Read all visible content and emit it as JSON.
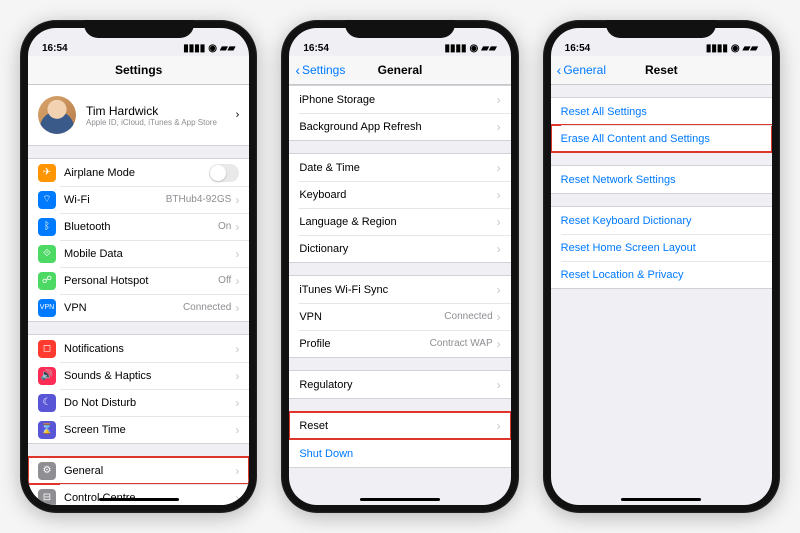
{
  "status": {
    "time": "16:54"
  },
  "phone1": {
    "title": "Settings",
    "profile": {
      "name": "Tim Hardwick",
      "sub": "Apple ID, iCloud, iTunes & App Store"
    },
    "groupA": [
      {
        "icon": "airplane-icon",
        "bg": "#ff9500",
        "label": "Airplane Mode",
        "type": "switch"
      },
      {
        "icon": "wifi-icon",
        "bg": "#007aff",
        "label": "Wi-Fi",
        "detail": "BTHub4-92GS"
      },
      {
        "icon": "bluetooth-icon",
        "bg": "#007aff",
        "label": "Bluetooth",
        "detail": "On"
      },
      {
        "icon": "mobiledata-icon",
        "bg": "#4cd964",
        "label": "Mobile Data"
      },
      {
        "icon": "hotspot-icon",
        "bg": "#4cd964",
        "label": "Personal Hotspot",
        "detail": "Off"
      },
      {
        "icon": "vpn-icon",
        "bg": "#007aff",
        "label": "VPN",
        "detail": "Connected"
      }
    ],
    "groupB": [
      {
        "icon": "notifications-icon",
        "bg": "#ff3b30",
        "label": "Notifications"
      },
      {
        "icon": "sounds-icon",
        "bg": "#ff2d55",
        "label": "Sounds & Haptics"
      },
      {
        "icon": "dnd-icon",
        "bg": "#5856d6",
        "label": "Do Not Disturb"
      },
      {
        "icon": "screentime-icon",
        "bg": "#5856d6",
        "label": "Screen Time"
      }
    ],
    "groupC": [
      {
        "icon": "general-icon",
        "bg": "#8e8e93",
        "label": "General",
        "highlight": true
      },
      {
        "icon": "control-icon",
        "bg": "#8e8e93",
        "label": "Control Centre"
      }
    ]
  },
  "phone2": {
    "title": "General",
    "back": "Settings",
    "groupA": [
      {
        "label": "iPhone Storage"
      },
      {
        "label": "Background App Refresh"
      }
    ],
    "groupB": [
      {
        "label": "Date & Time"
      },
      {
        "label": "Keyboard"
      },
      {
        "label": "Language & Region"
      },
      {
        "label": "Dictionary"
      }
    ],
    "groupC": [
      {
        "label": "iTunes Wi-Fi Sync"
      },
      {
        "label": "VPN",
        "detail": "Connected"
      },
      {
        "label": "Profile",
        "detail": "Contract WAP"
      }
    ],
    "groupD": [
      {
        "label": "Regulatory"
      }
    ],
    "groupE": [
      {
        "label": "Reset",
        "highlight": true
      }
    ],
    "shutdown": "Shut Down"
  },
  "phone3": {
    "title": "Reset",
    "back": "General",
    "groupA": [
      {
        "label": "Reset All Settings"
      },
      {
        "label": "Erase All Content and Settings",
        "highlight": true
      }
    ],
    "groupB": [
      {
        "label": "Reset Network Settings"
      }
    ],
    "groupC": [
      {
        "label": "Reset Keyboard Dictionary"
      },
      {
        "label": "Reset Home Screen Layout"
      },
      {
        "label": "Reset Location & Privacy"
      }
    ]
  }
}
